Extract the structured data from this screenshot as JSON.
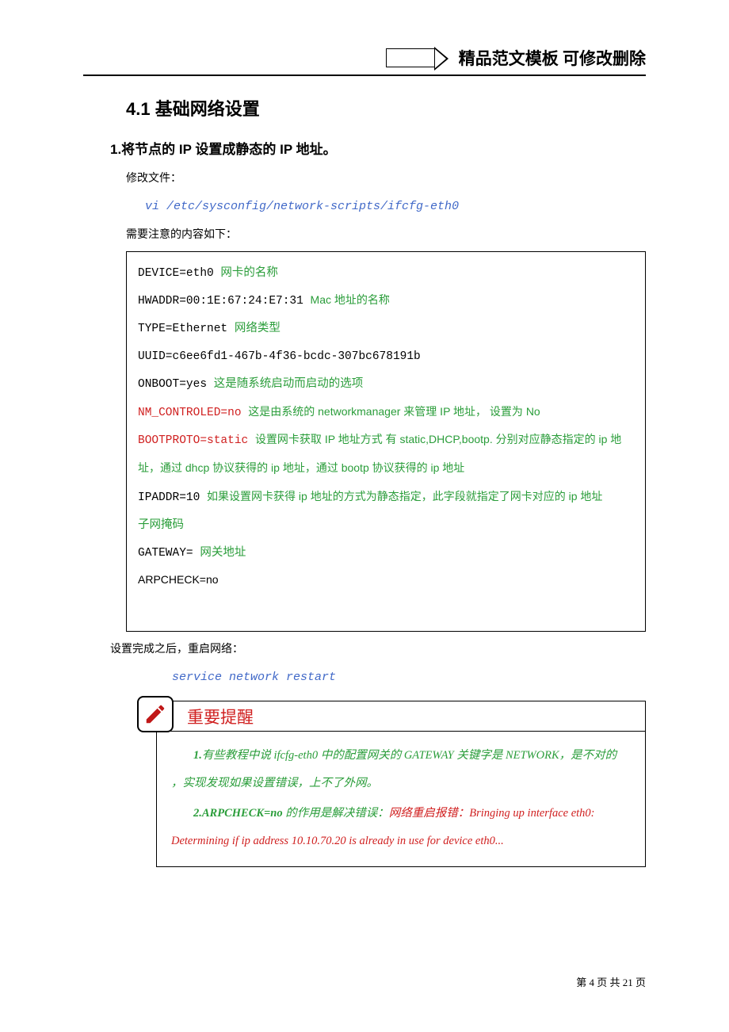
{
  "header": {
    "banner_text": "精品范文模板  可修改删除"
  },
  "section": {
    "title": "4.1 基础网络设置"
  },
  "step1": {
    "heading": "1.将节点的 IP 设置成静态的 IP 地址。",
    "modify_label": "修改文件：",
    "cmd1": "vi /etc/sysconfig/network-scripts/ifcfg-eth0",
    "attention_label": "需要注意的内容如下：",
    "code": {
      "l1a": "DEVICE=eth0  ",
      "l1b": "网卡的名称",
      "l2a": "HWADDR=00:1E:67:24:E7:31   ",
      "l2b": "Mac 地址的名称",
      "l3a": "TYPE=Ethernet  ",
      "l3b": "网络类型",
      "l4": "UUID=c6ee6fd1-467b-4f36-bcdc-307bc678191b",
      "l5a": "ONBOOT=yes     ",
      "l5b": "这是随系统启动而启动的选项",
      "l6a": "NM_CONTROLED=no ",
      "l6b": "这是由系统的 networkmanager 来管理 IP 地址，  设置为 No",
      "l7a": "BOOTPROTO=static  ",
      "l7b": "设置网卡获取 IP 地址方式  有 static,DHCP,bootp.  分别对应静态指定的 ip 地址，通过 dhcp 协议获得的 ip 地址，通过 bootp 协议获得的 ip 地址",
      "l8a": "IPADDR=10  ",
      "l8b": "如果设置网卡获得 ip 地址的方式为静态指定，此字段就指定了网卡对应的 ip 地址",
      "l9": "  子网掩码",
      "l10a": "GATEWAY=  ",
      "l10b": "网关地址",
      "l11": "ARPCHECK=no"
    },
    "after_label": "设置完成之后，重启网络：",
    "cmd2": "service network restart"
  },
  "notice": {
    "title": "重要提醒",
    "line1_prefix": "1.",
    "line1_g1": "有些教程中说 ifcfg-eth0 中的配置网关的 GATEWAY 关键字是  NETWORK，是不对的 ，实现发现如果设置错误，上不了外网。",
    "line2_prefix": "2.ARPCHECK=no ",
    "line2_g": "的作用是解决错误：",
    "line2_r": "网络重启报错：Bringing up interface eth0:  Determining if ip address 10.10.70.20 is already in use for device eth0..."
  },
  "footer": {
    "text": "第 4 页 共 21 页"
  }
}
